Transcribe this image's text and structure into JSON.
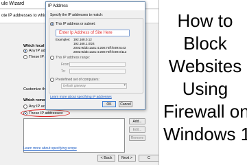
{
  "wizard": {
    "title": "ule Wizard",
    "subtitle": "ote IP addresses to which this rule",
    "local_heading": "Which local",
    "local_options": [
      "Any IP ad",
      "These IP a"
    ],
    "customize_text": "Customize the i",
    "remote_heading": "Which remot",
    "remote_options": [
      "Any IP ac",
      "These IP addresses:"
    ],
    "buttons": {
      "add": "Add...",
      "edit": "Edit...",
      "remove": "Remove"
    },
    "learn_link": "Learn more about specifying scope",
    "nav": {
      "back": "< Back",
      "next": "Next >",
      "cancel": "C"
    }
  },
  "ip_dialog": {
    "title": "IP Address",
    "spec_label": "Specify the IP addresses to match:",
    "option_address": "This IP address or subnet:",
    "input_value": "Enter Ip Address of Site Here",
    "examples_label": "Examples:",
    "examples": [
      "192.168.0.12",
      "192.168.1.0/24",
      "2002:9d3b:1a31:4:208:74ff:fe39:6c43",
      "2002:9d3b:1a31:4:208:74ff:fe39:0/112"
    ],
    "option_range": "This IP address range:",
    "from_label": "From:",
    "to_label": "To:",
    "option_predefined": "Predefined set of computers:",
    "predefined_value": "Default gateway",
    "learn_link": "Learn more about specifying IP addresses",
    "ok": "OK",
    "cancel": "Cancel"
  },
  "headline": {
    "lines": [
      "How to",
      "Block",
      "Websites",
      "Using",
      "Firewall on",
      "Windows 1"
    ]
  },
  "colors": {
    "highlight": "#e02020",
    "input_text": "#e23030",
    "link": "#1a5bc4"
  }
}
